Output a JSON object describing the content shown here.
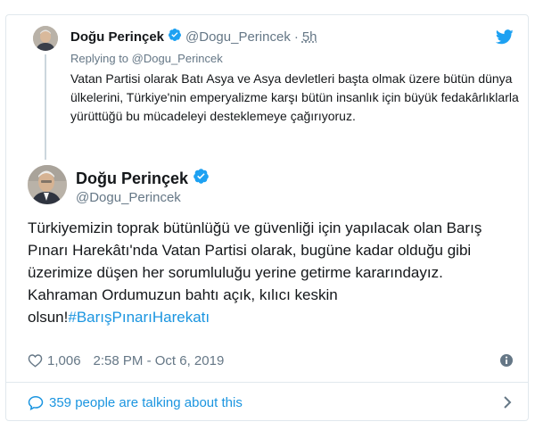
{
  "parent_tweet": {
    "author_name": "Doğu Perinçek",
    "handle": "@Dogu_Perincek",
    "separator": "·",
    "time": "5h",
    "replying_prefix": "Replying to",
    "replying_handle": "@Dogu_Perincek",
    "text": "Vatan Partisi olarak Batı Asya ve Asya devletleri başta olmak üzere bütün dünya ülkelerini, Türkiye'nin emperyalizme karşı bütün insanlık için büyük fedakârlıklarla yürüttüğü bu mücadeleyi desteklemeye çağırıyoruz."
  },
  "main_tweet": {
    "author_name": "Doğu Perinçek",
    "handle": "@Dogu_Perincek",
    "text": "Türkiyemizin toprak bütünlüğü ve güvenliği için yapılacak olan Barış Pınarı Harekâtı'nda Vatan Partisi olarak, bugüne kadar olduğu gibi üzerimize düşen her sorumluluğu yerine getirme kararındayız. Kahraman Ordumuzun bahtı açık, kılıcı keskin olsun!",
    "hashtag": "#BarışPınarıHarekatı",
    "like_count": "1,006",
    "timestamp": "2:58 PM - Oct 6, 2019"
  },
  "conversation": {
    "label": "359 people are talking about this"
  },
  "colors": {
    "link": "#1b95e0",
    "muted": "#657786",
    "verified": "#1da1f2",
    "border": "#e1e8ed"
  },
  "icons": {
    "brand": "twitter-bird-icon",
    "verified": "verified-badge-icon",
    "like": "heart-icon",
    "info": "info-icon",
    "conversation": "speech-bubble-icon",
    "more": "chevron-right-icon"
  }
}
